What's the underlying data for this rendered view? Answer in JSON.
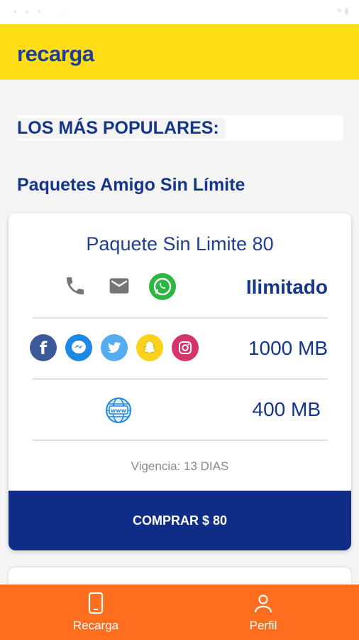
{
  "app": {
    "title": "recarga",
    "colors": {
      "header": "#ffde17",
      "primary": "#16368a",
      "button": "#0f2c86",
      "bottom_nav": "#ff6d1f"
    }
  },
  "main": {
    "section_title": "LOS MÁS POPULARES:",
    "subtitle": "Paquetes Amigo Sin Límite"
  },
  "card": {
    "package_name": "Paquete Sin Limite 80",
    "rows": [
      {
        "icons": [
          "phone-icon",
          "mail-icon",
          "whatsapp-icon"
        ],
        "value": "Ilimitado"
      },
      {
        "icons": [
          "facebook-icon",
          "messenger-icon",
          "twitter-icon",
          "snapchat-icon",
          "instagram-icon"
        ],
        "value": "1000 MB"
      },
      {
        "icons": [
          "globe-www-icon"
        ],
        "value": "400 MB"
      }
    ],
    "validity": "Vigencia: 13 DIAS",
    "buy_label": "COMPRAR $ 80"
  },
  "bottom_nav": {
    "items": [
      {
        "label": "Recarga",
        "icon": "phone-device-icon"
      },
      {
        "label": "Perfil",
        "icon": "person-icon"
      }
    ]
  }
}
